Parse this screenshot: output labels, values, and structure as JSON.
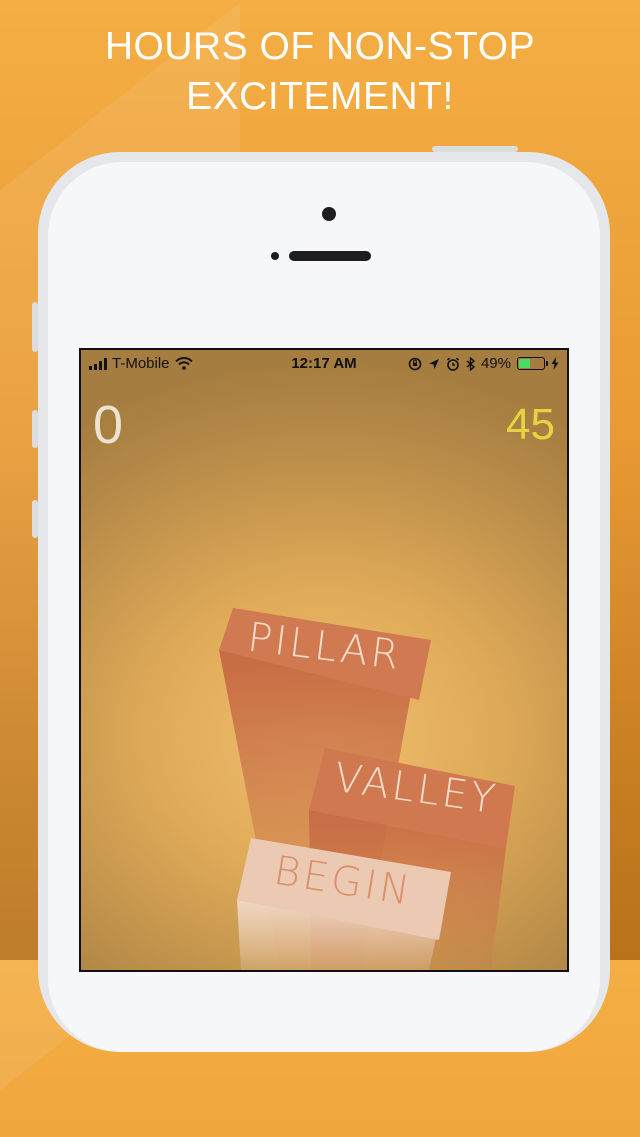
{
  "promo": {
    "line1": "HOURS OF NON-STOP",
    "line2": "EXCITEMENT!"
  },
  "status_bar": {
    "carrier": "T-Mobile",
    "time": "12:17 AM",
    "battery_percent": "49%",
    "battery_level": 0.49,
    "icons": [
      "signal-bars-icon",
      "wifi-icon",
      "orientation-lock-icon",
      "location-arrow-icon",
      "alarm-icon",
      "bluetooth-icon",
      "battery-icon",
      "charging-bolt-icon"
    ]
  },
  "game": {
    "score": "0",
    "best": "45",
    "blocks": {
      "pillar": "PILLAR",
      "valley": "VALLEY",
      "begin": "BEGIN"
    }
  },
  "colors": {
    "background": "#f4ae44",
    "block_top": "#d0764f",
    "block_side": "#c26845",
    "begin_block": "#ecc8b2",
    "best_score": "#e4d442"
  }
}
